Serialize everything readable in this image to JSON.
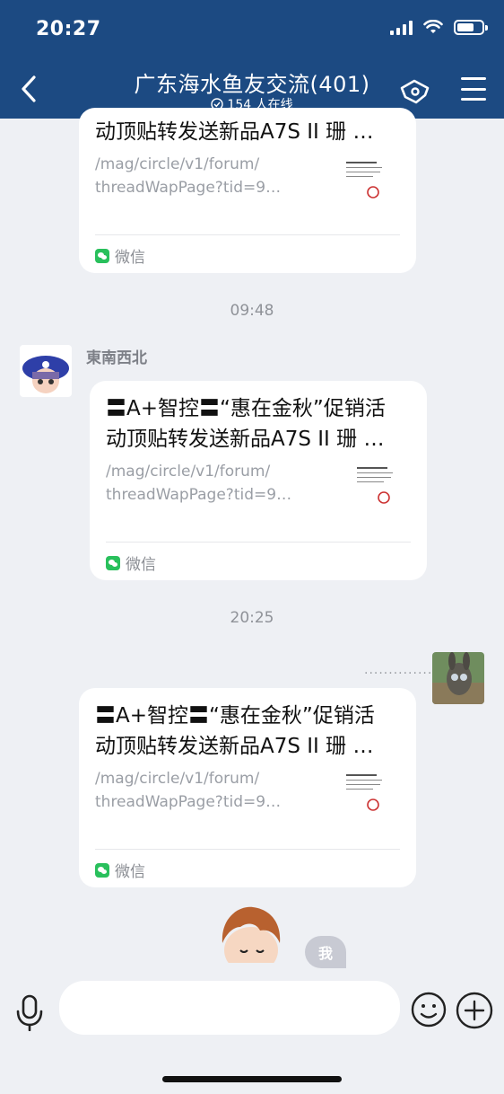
{
  "status_bar": {
    "time": "20:27"
  },
  "nav": {
    "title": "广东海水鱼友交流(401)",
    "subtitle": "154 人在线",
    "back_icon": "chevron-left-icon",
    "group_icon": "group-manage-icon",
    "menu_icon": "menu-icon"
  },
  "messages": [
    {
      "title_line1": "",
      "title_line2": "动顶贴转发送新品A7S II 珊 …",
      "url_line1": "/mag/circle/v1/forum/",
      "url_line2": "threadWapPage?tid=9…",
      "source": "微信"
    },
    {
      "timestamp": "09:48",
      "sender": "東南西北",
      "title_line1": "〓A+智控〓“惠在金秋”促销活",
      "title_line2": "动顶贴转发送新品A7S II 珊 …",
      "url_line1": "/mag/circle/v1/forum/",
      "url_line2": "threadWapPage?tid=9…",
      "source": "微信"
    },
    {
      "timestamp": "20:25",
      "sender_dots": "..............",
      "title_line1": "〓A+智控〓“惠在金秋”促销活",
      "title_line2": "动顶贴转发送新品A7S II 珊 …",
      "url_line1": "/mag/circle/v1/forum/",
      "url_line2": "threadWapPage?tid=9…",
      "source": "微信"
    }
  ],
  "me_label": "我",
  "input": {
    "placeholder": ""
  },
  "colors": {
    "header": "#1c4a82",
    "background": "#eef0f4",
    "wechat": "#29c05c"
  }
}
